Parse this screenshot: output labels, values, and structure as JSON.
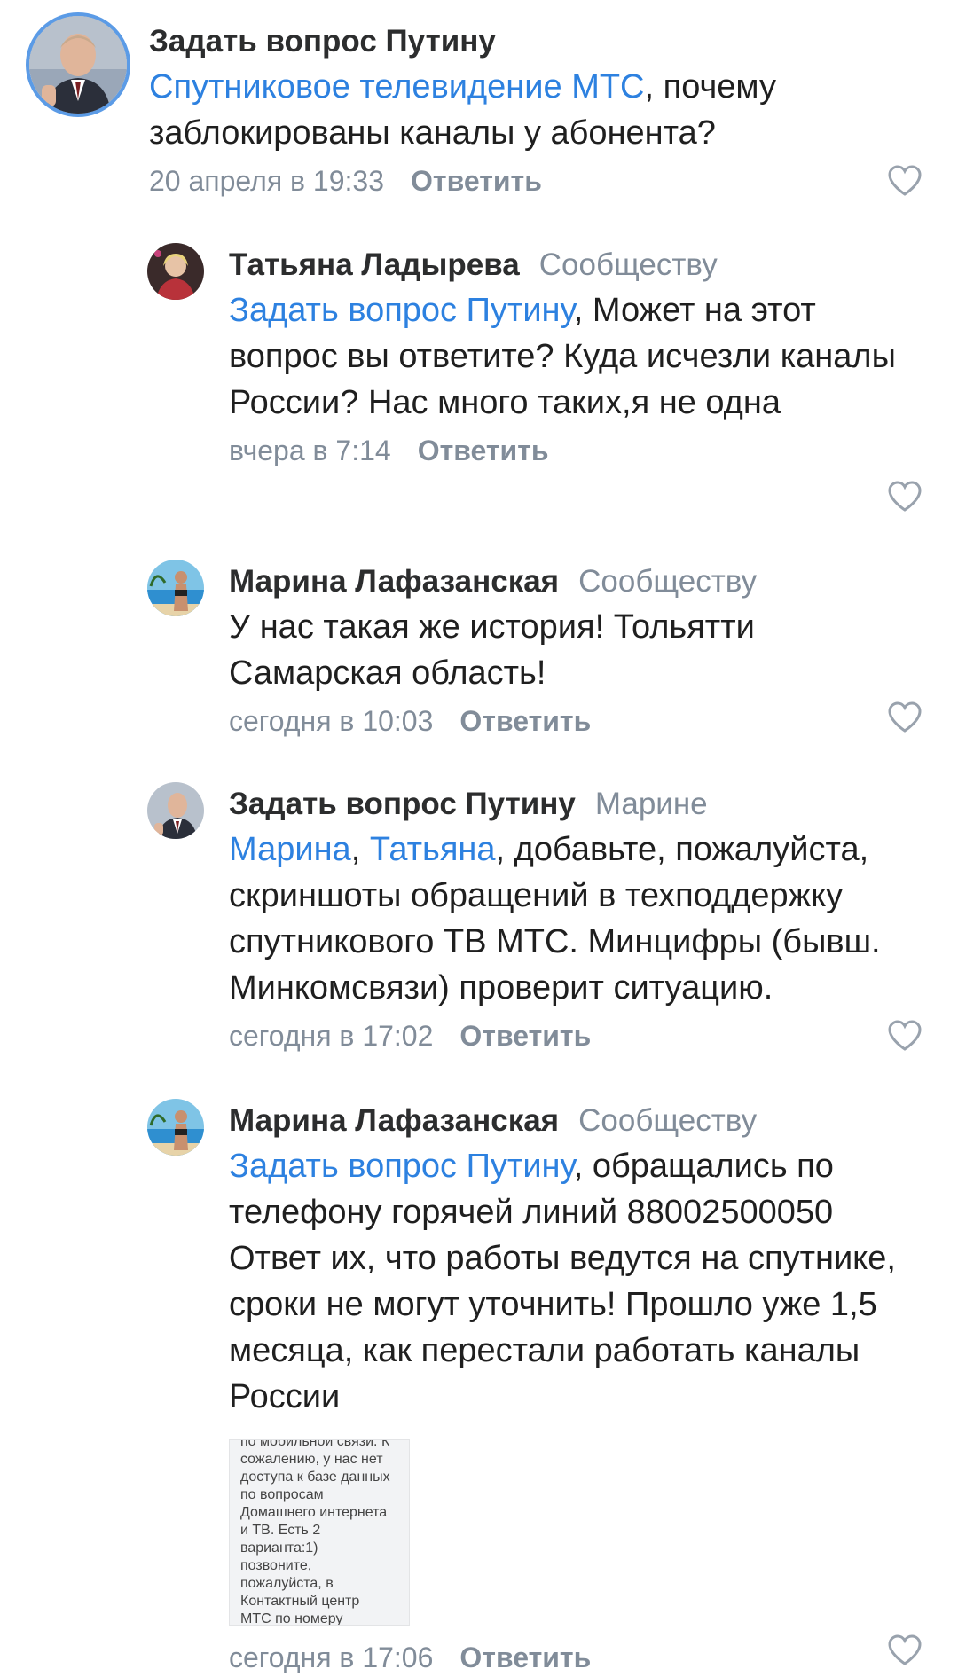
{
  "comments": [
    {
      "author": "Задать вопрос Путину",
      "recipient": "",
      "mentions": [
        "Спутниковое телевидение МТС"
      ],
      "text_after_mentions": ", почему заблокированы каналы у абонента?",
      "timestamp": "20 апреля в 19:33",
      "reply_label": "Ответить",
      "avatar_icon": "putin-portrait-avatar",
      "like_icon": "heart-outline-icon"
    },
    {
      "author": "Татьяна Ладырева",
      "recipient": "Сообществу",
      "mentions": [
        "Задать вопрос Путину"
      ],
      "text_after_mentions": ", Может на этот вопрос вы ответите? Куда исчезли каналы России? Нас много таких,я не одна",
      "timestamp": "вчера в 7:14",
      "reply_label": "Ответить",
      "avatar_icon": "woman-portrait-avatar",
      "like_icon": "heart-outline-icon"
    },
    {
      "author": "Марина Лафазанская",
      "recipient": "Сообществу",
      "mentions": [],
      "text_after_mentions": "У нас такая же история! Тольятти Самарская область!",
      "timestamp": "сегодня в 10:03",
      "reply_label": "Ответить",
      "avatar_icon": "beach-photo-avatar",
      "like_icon": "heart-outline-icon"
    },
    {
      "author": "Задать вопрос Путину",
      "recipient": "Марине",
      "mentions": [
        "Марина",
        "Татьяна"
      ],
      "mention_separator": ", ",
      "text_after_mentions": ", добавьте, пожалуйста, скриншоты обращений в техподдержку спутникового ТВ МТС. Минцифры (бывш. Минкомсвязи) проверит ситуацию.",
      "timestamp": "сегодня в 17:02",
      "reply_label": "Ответить",
      "avatar_icon": "putin-portrait-avatar",
      "like_icon": "heart-outline-icon"
    },
    {
      "author": "Марина Лафазанская",
      "recipient": "Сообществу",
      "mentions": [
        "Задать вопрос Путину"
      ],
      "text_after_mentions": ", обращались по телефону горячей линий 88002500050 Ответ их, что работы ведутся на спутнике, сроки не могут уточнить! Прошло уже 1,5 месяца, как перестали работать каналы России",
      "attachment_lines": [
        "по мобильной связи. К",
        "сожалению, у нас нет",
        "доступа к базе данных",
        "по вопросам",
        "Домашнего интернета",
        "и ТВ. Есть 2",
        "варианта:1)",
        "позвоните,",
        "пожалуйста, в",
        "Контактный центр",
        "МТС по номеру"
      ],
      "timestamp": "сегодня в 17:06",
      "reply_label": "Ответить",
      "avatar_icon": "beach-photo-avatar",
      "like_icon": "heart-outline-icon"
    }
  ],
  "colors": {
    "mention": "#2d81e0",
    "secondary": "#818c99",
    "text": "#1f1f1f",
    "avatar_ring": "#5b9be6"
  }
}
